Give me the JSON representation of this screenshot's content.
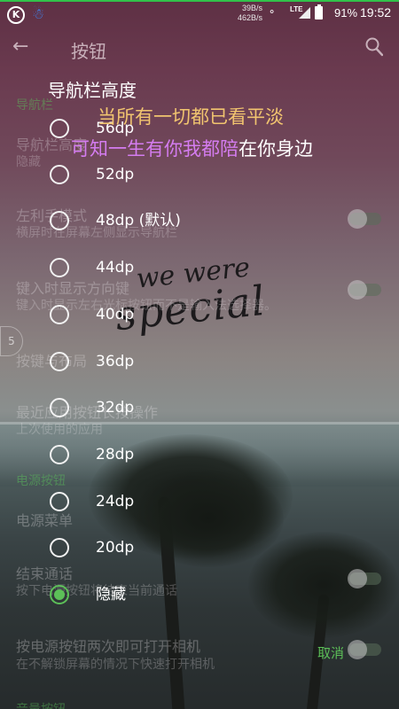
{
  "status_bar": {
    "speed_up": "39B/s",
    "speed_down": "462B/s",
    "network": "LTE",
    "battery": "91%",
    "time": "19:52"
  },
  "toolbar": {
    "title": "按钮"
  },
  "settings": {
    "category_nav": "导航栏",
    "nav_height_title": "导航栏高度",
    "nav_height_value": "隐藏",
    "left_hand_title": "左利手模式",
    "left_hand_sub": "横屏时在屏幕左侧显示导航栏",
    "ime_title": "键入时显示方向键",
    "ime_sub": "键入时显示左右光标按钮而不是输入法选择器。",
    "layout_title": "按键与布局",
    "recent_title": "最近应用按钮长按操作",
    "recent_sub": "上次使用的应用",
    "category_power": "电源按钮",
    "power_menu_title": "电源菜单",
    "end_call_title": "结束通话",
    "end_call_sub": "按下电源按钮将结束当前通话",
    "camera_title": "按电源按钮两次即可打开相机",
    "camera_sub": "在不解锁屏幕的情况下快速打开相机",
    "bottom_cat": "音量按钮",
    "scroll_index": "5"
  },
  "dialog": {
    "title": "导航栏高度",
    "options": [
      "56dp",
      "52dp",
      "48dp (默认)",
      "44dp",
      "40dp",
      "36dp",
      "32dp",
      "28dp",
      "24dp",
      "20dp",
      "隐藏"
    ],
    "selected_index": 10,
    "cancel_label": "取消"
  },
  "lyrics": {
    "line1": "当所有一切都已看平淡",
    "line2_sung": "可知一生有你我都陪",
    "line2_rest": "在你身边"
  },
  "wallpaper": {
    "script_line1": "we were",
    "script_line2": "special"
  },
  "colors": {
    "accent": "#5cbf58",
    "lyric_current": "#f1c46f",
    "lyric_sung": "#d47cf0"
  }
}
